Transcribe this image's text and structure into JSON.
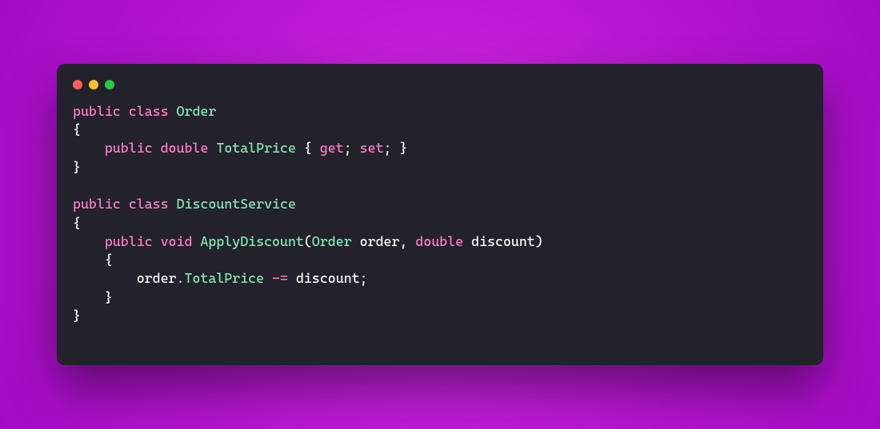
{
  "colors": {
    "window_bg": "#22212c",
    "bg_gradient_inner": "#d82de8",
    "bg_gradient_outer": "#a40bc5",
    "keyword": "#ff7ac6",
    "identifier": "#87e6b0",
    "text": "#f8f8f2",
    "traffic_red": "#ff5f56",
    "traffic_yellow": "#ffbd2e",
    "traffic_green": "#27c93f"
  },
  "code": {
    "language": "csharp",
    "tokens": {
      "l1_t1": "public",
      "l1_t2": "class",
      "l1_t3": "Order",
      "l2_t1": "{",
      "l3_t1": "public",
      "l3_t2": "double",
      "l3_t3": "TotalPrice",
      "l3_t4": "{",
      "l3_t5": "get",
      "l3_t6": ";",
      "l3_t7": "set",
      "l3_t8": ";",
      "l3_t9": "}",
      "l4_t1": "}",
      "l6_t1": "public",
      "l6_t2": "class",
      "l6_t3": "DiscountService",
      "l7_t1": "{",
      "l8_t1": "public",
      "l8_t2": "void",
      "l8_t3": "ApplyDiscount",
      "l8_t4": "(",
      "l8_t5": "Order",
      "l8_t6": "order",
      "l8_t7": ",",
      "l8_t8": "double",
      "l8_t9": "discount",
      "l8_t10": ")",
      "l9_t1": "{",
      "l10_t1": "order",
      "l10_t2": ".",
      "l10_t3": "TotalPrice",
      "l10_t4": "-=",
      "l10_t5": "discount",
      "l10_t6": ";",
      "l11_t1": "}",
      "l12_t1": "}"
    }
  }
}
